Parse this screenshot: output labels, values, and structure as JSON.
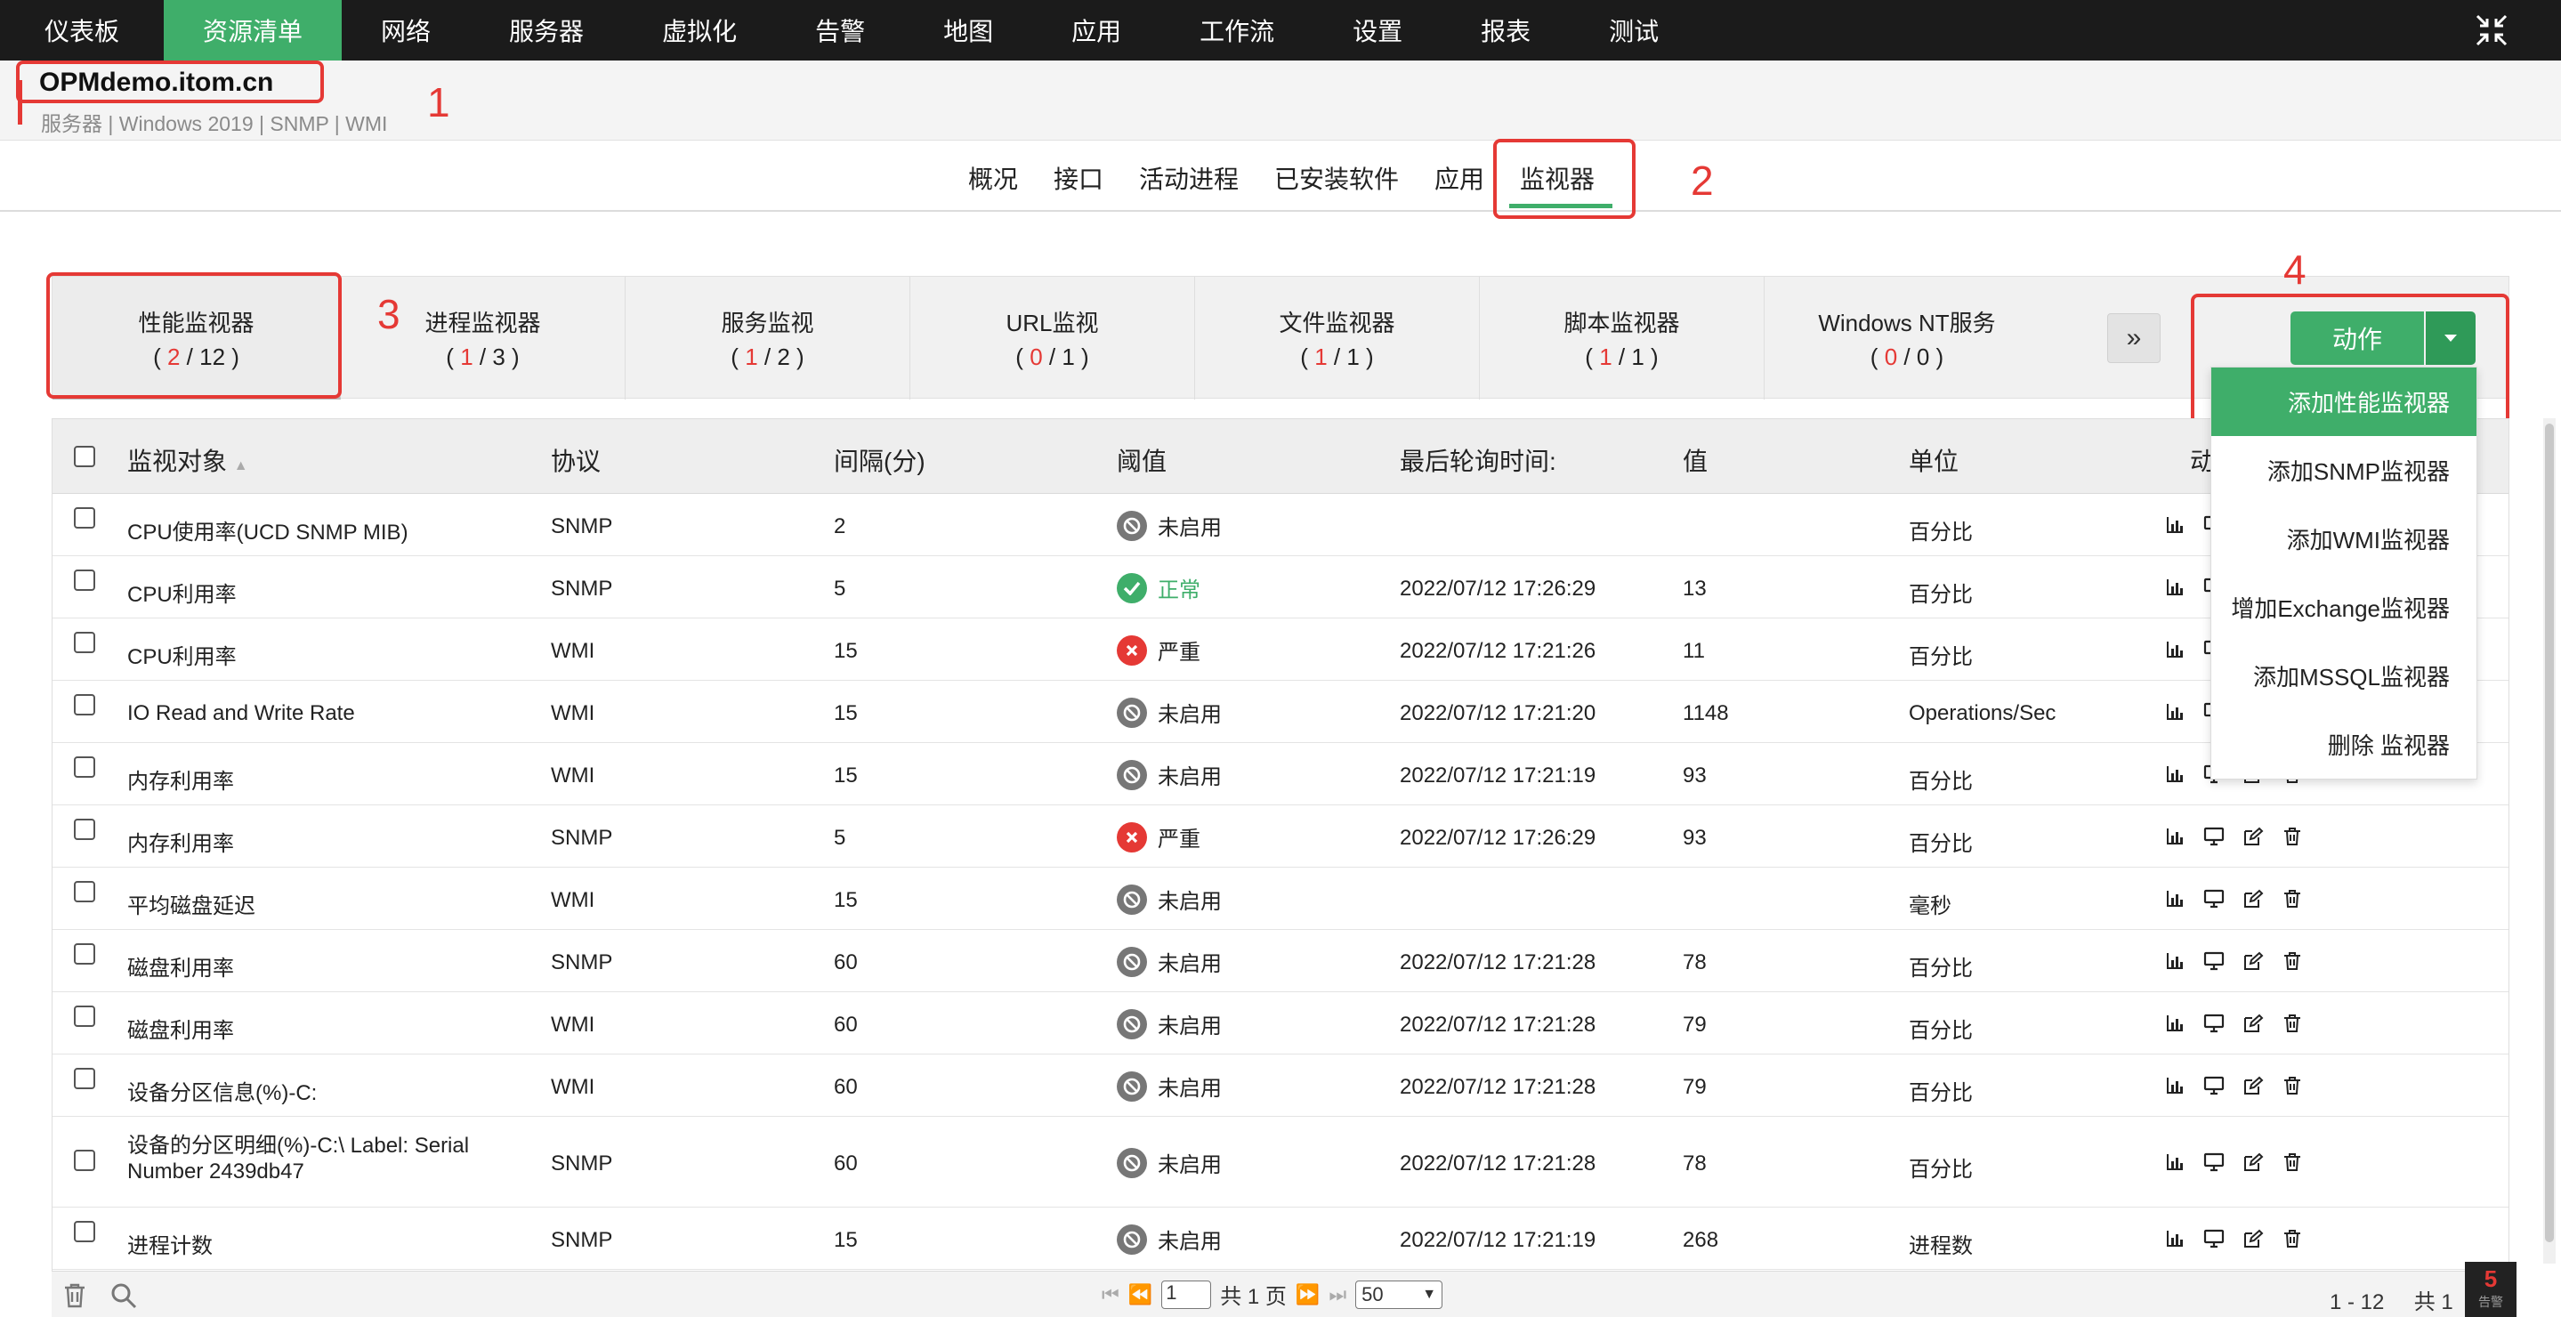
{
  "nav": {
    "items": [
      "仪表板",
      "资源清单",
      "网络",
      "服务器",
      "虚拟化",
      "告警",
      "地图",
      "应用",
      "工作流",
      "设置",
      "报表",
      "测试"
    ],
    "active_index": 1
  },
  "host": {
    "name": "OPMdemo.itom.cn",
    "sub": "服务器 | Windows 2019  | SNMP  | WMI"
  },
  "annotations": [
    "1",
    "2",
    "3",
    "4"
  ],
  "tabs": [
    "概况",
    "接口",
    "活动进程",
    "已安装软件",
    "应用",
    "监视器"
  ],
  "active_tab": "监视器",
  "subtabs": [
    {
      "title": "性能监视器",
      "a": "2",
      "b": "12"
    },
    {
      "title": "进程监视器",
      "a": "1",
      "b": "3"
    },
    {
      "title": "服务监视",
      "a": "1",
      "b": "2"
    },
    {
      "title": "URL监视",
      "a": "0",
      "b": "1"
    },
    {
      "title": "文件监视器",
      "a": "1",
      "b": "1"
    },
    {
      "title": "脚本监视器",
      "a": "1",
      "b": "1"
    },
    {
      "title": "Windows NT服务",
      "a": "0",
      "b": "0"
    }
  ],
  "more_label": "»",
  "action": {
    "label": "动作",
    "menu": [
      "添加性能监视器",
      "添加SNMP监视器",
      "添加WMI监视器",
      "增加Exchange监视器",
      "添加MSSQL监视器",
      "删除 监视器"
    ]
  },
  "table": {
    "headers": [
      "监视对象",
      "协议",
      "间隔(分)",
      "阈值",
      "最后轮询时间:",
      "值",
      "单位",
      "动"
    ],
    "rows": [
      {
        "name": "CPU使用率(UCD SNMP MIB)",
        "protocol": "SNMP",
        "interval": "2",
        "status": "未启用",
        "status_type": "disabled",
        "time": "",
        "value": "",
        "unit": "百分比"
      },
      {
        "name": "CPU利用率",
        "protocol": "SNMP",
        "interval": "5",
        "status": "正常",
        "status_type": "ok",
        "time": "2022/07/12 17:26:29",
        "value": "13",
        "unit": "百分比"
      },
      {
        "name": "CPU利用率",
        "protocol": "WMI",
        "interval": "15",
        "status": "严重",
        "status_type": "critical",
        "time": "2022/07/12 17:21:26",
        "value": "11",
        "unit": "百分比"
      },
      {
        "name": "IO Read and Write Rate",
        "protocol": "WMI",
        "interval": "15",
        "status": "未启用",
        "status_type": "disabled",
        "time": "2022/07/12 17:21:20",
        "value": "1148",
        "unit": "Operations/Sec"
      },
      {
        "name": "内存利用率",
        "protocol": "WMI",
        "interval": "15",
        "status": "未启用",
        "status_type": "disabled",
        "time": "2022/07/12 17:21:19",
        "value": "93",
        "unit": "百分比"
      },
      {
        "name": "内存利用率",
        "protocol": "SNMP",
        "interval": "5",
        "status": "严重",
        "status_type": "critical",
        "time": "2022/07/12 17:26:29",
        "value": "93",
        "unit": "百分比"
      },
      {
        "name": "平均磁盘延迟",
        "protocol": "WMI",
        "interval": "15",
        "status": "未启用",
        "status_type": "disabled",
        "time": "",
        "value": "",
        "unit": "毫秒"
      },
      {
        "name": "磁盘利用率",
        "protocol": "SNMP",
        "interval": "60",
        "status": "未启用",
        "status_type": "disabled",
        "time": "2022/07/12 17:21:28",
        "value": "78",
        "unit": "百分比"
      },
      {
        "name": "磁盘利用率",
        "protocol": "WMI",
        "interval": "60",
        "status": "未启用",
        "status_type": "disabled",
        "time": "2022/07/12 17:21:28",
        "value": "79",
        "unit": "百分比"
      },
      {
        "name": "设备分区信息(%)-C:",
        "protocol": "WMI",
        "interval": "60",
        "status": "未启用",
        "status_type": "disabled",
        "time": "2022/07/12 17:21:28",
        "value": "79",
        "unit": "百分比"
      },
      {
        "name": "设备的分区明细(%)-C:\\ Label: Serial",
        "name2": "Number 2439db47",
        "protocol": "SNMP",
        "interval": "60",
        "status": "未启用",
        "status_type": "disabled",
        "time": "2022/07/12 17:21:28",
        "value": "78",
        "unit": "百分比"
      },
      {
        "name": "进程计数",
        "protocol": "SNMP",
        "interval": "15",
        "status": "未启用",
        "status_type": "disabled",
        "time": "2022/07/12 17:21:19",
        "value": "268",
        "unit": "进程数"
      }
    ]
  },
  "pager": {
    "page": "1",
    "total": "共 1 页",
    "per_page": "50",
    "range": "1 - 12",
    "total_count": "共 1"
  },
  "alarm": {
    "count": "5",
    "label": "告警"
  },
  "colors": {
    "accent": "#3fae6a",
    "annotation": "#e53935",
    "nav_bg": "#1b1b1b"
  }
}
